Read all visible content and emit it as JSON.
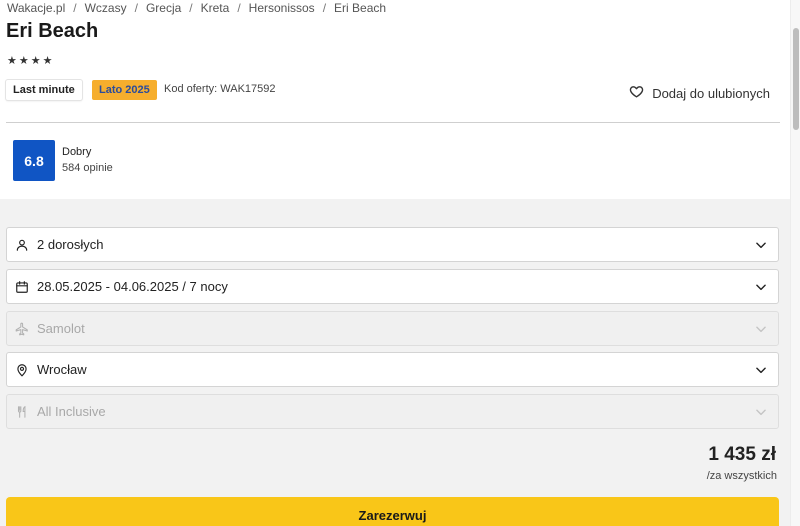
{
  "breadcrumb": [
    "Wakacje.pl",
    "Wczasy",
    "Grecja",
    "Kreta",
    "Hersonissos",
    "Eri Beach"
  ],
  "hotel": {
    "name": "Eri Beach",
    "stars": "★★★★"
  },
  "badges": {
    "last_minute": "Last minute",
    "season": "Lato 2025"
  },
  "offer_code": "Kod oferty: WAK17592",
  "favorite_label": "Dodaj do ulubionych",
  "rating": {
    "score": "6.8",
    "label": "Dobry",
    "count": "584 opinie"
  },
  "filters": {
    "travelers": "2 dorosłych",
    "dates": "28.05.2025 - 04.06.2025 / 7 nocy",
    "transport": "Samolot",
    "departure": "Wrocław",
    "board": "All Inclusive"
  },
  "price": {
    "amount": "1 435 zł",
    "note": "/za wszystkich"
  },
  "book_label": "Zarezerwuj",
  "colors": {
    "accent_yellow": "#f9c618",
    "season_orange": "#f6ae2d",
    "score_blue": "#1055c4"
  },
  "icons": {
    "travelers": "user-icon",
    "dates": "calendar-icon",
    "transport": "plane-icon",
    "departure": "location-pin-icon",
    "board": "cutlery-icon",
    "favorite": "heart-icon",
    "expand": "chevron-down-icon"
  }
}
